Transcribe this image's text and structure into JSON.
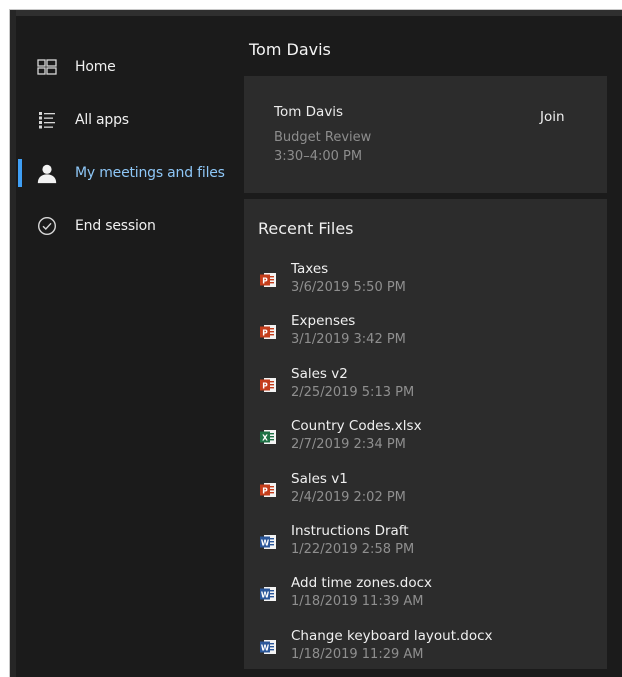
{
  "sidebar": {
    "items": [
      {
        "label": "Home",
        "icon": "home-dashboard-icon"
      },
      {
        "label": "All apps",
        "icon": "all-apps-list-icon"
      },
      {
        "label": "My meetings and files",
        "icon": "person-icon",
        "active": true
      },
      {
        "label": "End session",
        "icon": "checkmark-circle-icon"
      }
    ],
    "accent_color": "#3f9ff5"
  },
  "header": {
    "user_name": "Tom Davis"
  },
  "meeting": {
    "organizer": "Tom Davis",
    "subject": "Budget Review",
    "time": "3:30–4:00 PM",
    "join_label": "Join"
  },
  "recent_files": {
    "title": "Recent Files",
    "files": [
      {
        "name": "Taxes",
        "date": "3/6/2019 5:50 PM",
        "type": "powerpoint"
      },
      {
        "name": "Expenses",
        "date": "3/1/2019 3:42 PM",
        "type": "powerpoint"
      },
      {
        "name": "Sales v2",
        "date": "2/25/2019 5:13 PM",
        "type": "powerpoint"
      },
      {
        "name": "Country Codes.xlsx",
        "date": "2/7/2019 2:34 PM",
        "type": "excel"
      },
      {
        "name": "Sales v1",
        "date": "2/4/2019 2:02 PM",
        "type": "powerpoint"
      },
      {
        "name": "Instructions Draft",
        "date": "1/22/2019 2:58 PM",
        "type": "word"
      },
      {
        "name": "Add time zones.docx",
        "date": "1/18/2019 11:39 AM",
        "type": "word"
      },
      {
        "name": "Change keyboard layout.docx",
        "date": "1/18/2019 11:29 AM",
        "type": "word"
      }
    ]
  },
  "colors": {
    "powerpoint": "#c43e1c",
    "excel": "#1e7145",
    "word": "#2b579a"
  }
}
